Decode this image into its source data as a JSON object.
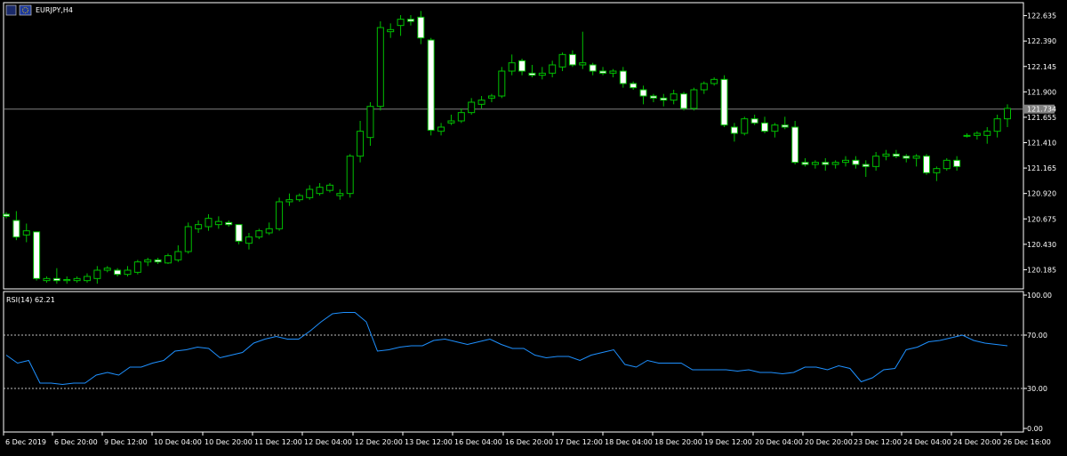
{
  "window": {
    "title": "EURJPY,H4",
    "icons": [
      "chart-window-icon",
      "eu-flag-icon"
    ]
  },
  "colors": {
    "background": "#000000",
    "grid": "#ffffff",
    "bull_candle": "#00c000",
    "bear_body": "#ffffff",
    "wick": "#00c000",
    "rsi_line": "#1e90ff",
    "bid_line": "#808080",
    "level_line": "#c0c0c0",
    "price_tag_bg": "#808080"
  },
  "chart_data": [
    {
      "type": "candlestick",
      "title": "EURJPY,H4",
      "ylim": [
        120.0,
        122.76
      ],
      "y_ticks": [
        "122.635",
        "122.390",
        "122.145",
        "121.900",
        "121.655",
        "121.410",
        "121.165",
        "120.920",
        "120.675",
        "120.430",
        "120.185"
      ],
      "current_price": "121.734",
      "x_labels": [
        "6 Dec 2019",
        "6 Dec 20:00",
        "9 Dec 12:00",
        "10 Dec 04:00",
        "10 Dec 20:00",
        "11 Dec 12:00",
        "12 Dec 04:00",
        "12 Dec 20:00",
        "13 Dec 12:00",
        "16 Dec 04:00",
        "16 Dec 20:00",
        "17 Dec 12:00",
        "18 Dec 04:00",
        "18 Dec 20:00",
        "19 Dec 12:00",
        "20 Dec 04:00",
        "20 Dec 20:00",
        "23 Dec 12:00",
        "24 Dec 04:00",
        "24 Dec 20:00",
        "26 Dec 16:00"
      ],
      "candles": [
        [
          120.72,
          120.74,
          120.68,
          120.7
        ],
        [
          120.66,
          120.75,
          120.47,
          120.5
        ],
        [
          120.52,
          120.63,
          120.45,
          120.56
        ],
        [
          120.55,
          120.55,
          120.08,
          120.1
        ],
        [
          120.08,
          120.12,
          120.06,
          120.1
        ],
        [
          120.1,
          120.2,
          120.05,
          120.08
        ],
        [
          120.08,
          120.12,
          120.05,
          120.09
        ],
        [
          120.08,
          120.12,
          120.06,
          120.1
        ],
        [
          120.08,
          120.15,
          120.06,
          120.12
        ],
        [
          120.1,
          120.22,
          120.05,
          120.18
        ],
        [
          120.18,
          120.22,
          120.16,
          120.2
        ],
        [
          120.18,
          120.2,
          120.12,
          120.14
        ],
        [
          120.14,
          120.22,
          120.12,
          120.18
        ],
        [
          120.16,
          120.28,
          120.14,
          120.26
        ],
        [
          120.26,
          120.3,
          120.22,
          120.28
        ],
        [
          120.28,
          120.3,
          120.24,
          120.26
        ],
        [
          120.25,
          120.34,
          120.24,
          120.32
        ],
        [
          120.28,
          120.42,
          120.26,
          120.36
        ],
        [
          120.36,
          120.64,
          120.34,
          120.6
        ],
        [
          120.58,
          120.66,
          120.54,
          120.62
        ],
        [
          120.6,
          120.72,
          120.56,
          120.68
        ],
        [
          120.62,
          120.7,
          120.58,
          120.65
        ],
        [
          120.64,
          120.66,
          120.6,
          120.62
        ],
        [
          120.62,
          120.62,
          120.43,
          120.46
        ],
        [
          120.44,
          120.54,
          120.38,
          120.5
        ],
        [
          120.5,
          120.58,
          120.48,
          120.56
        ],
        [
          120.54,
          120.64,
          120.52,
          120.58
        ],
        [
          120.58,
          120.88,
          120.56,
          120.84
        ],
        [
          120.84,
          120.92,
          120.8,
          120.86
        ],
        [
          120.86,
          120.92,
          120.84,
          120.9
        ],
        [
          120.88,
          121.0,
          120.86,
          120.96
        ],
        [
          120.92,
          121.02,
          120.9,
          120.98
        ],
        [
          120.95,
          121.02,
          120.93,
          121.0
        ],
        [
          120.9,
          120.96,
          120.86,
          120.92
        ],
        [
          120.92,
          121.3,
          120.88,
          121.28
        ],
        [
          121.28,
          121.62,
          121.22,
          121.52
        ],
        [
          121.46,
          121.8,
          121.38,
          121.76
        ],
        [
          121.76,
          122.58,
          121.72,
          122.52
        ],
        [
          122.48,
          122.56,
          122.42,
          122.5
        ],
        [
          122.54,
          122.64,
          122.44,
          122.6
        ],
        [
          122.6,
          122.64,
          122.54,
          122.58
        ],
        [
          122.62,
          122.68,
          122.36,
          122.42
        ],
        [
          122.4,
          122.42,
          121.48,
          121.53
        ],
        [
          121.52,
          121.6,
          121.48,
          121.56
        ],
        [
          121.6,
          121.68,
          121.58,
          121.62
        ],
        [
          121.62,
          121.74,
          121.6,
          121.7
        ],
        [
          121.7,
          121.84,
          121.68,
          121.8
        ],
        [
          121.78,
          121.86,
          121.74,
          121.82
        ],
        [
          121.84,
          121.88,
          121.8,
          121.86
        ],
        [
          121.86,
          122.14,
          121.84,
          122.1
        ],
        [
          122.1,
          122.26,
          122.06,
          122.18
        ],
        [
          122.2,
          122.22,
          122.06,
          122.1
        ],
        [
          122.08,
          122.16,
          122.04,
          122.06
        ],
        [
          122.06,
          122.14,
          122.02,
          122.08
        ],
        [
          122.08,
          122.2,
          122.04,
          122.16
        ],
        [
          122.14,
          122.28,
          122.1,
          122.26
        ],
        [
          122.26,
          122.3,
          122.14,
          122.16
        ],
        [
          122.16,
          122.48,
          122.12,
          122.18
        ],
        [
          122.16,
          122.18,
          122.06,
          122.1
        ],
        [
          122.1,
          122.14,
          122.06,
          122.08
        ],
        [
          122.08,
          122.12,
          122.04,
          122.1
        ],
        [
          122.1,
          122.14,
          121.94,
          121.98
        ],
        [
          121.98,
          122.0,
          121.92,
          121.94
        ],
        [
          121.92,
          121.96,
          121.78,
          121.86
        ],
        [
          121.86,
          121.88,
          121.8,
          121.84
        ],
        [
          121.84,
          121.88,
          121.76,
          121.82
        ],
        [
          121.82,
          121.92,
          121.78,
          121.88
        ],
        [
          121.88,
          121.9,
          121.72,
          121.74
        ],
        [
          121.74,
          121.94,
          121.72,
          121.92
        ],
        [
          121.92,
          122.0,
          121.88,
          121.98
        ],
        [
          121.98,
          122.04,
          121.96,
          122.02
        ],
        [
          122.02,
          122.06,
          121.56,
          121.58
        ],
        [
          121.56,
          121.6,
          121.42,
          121.5
        ],
        [
          121.5,
          121.66,
          121.48,
          121.64
        ],
        [
          121.64,
          121.68,
          121.58,
          121.6
        ],
        [
          121.6,
          121.66,
          121.5,
          121.52
        ],
        [
          121.52,
          121.6,
          121.46,
          121.58
        ],
        [
          121.58,
          121.66,
          121.54,
          121.56
        ],
        [
          121.56,
          121.62,
          121.2,
          121.22
        ],
        [
          121.22,
          121.26,
          121.18,
          121.2
        ],
        [
          121.2,
          121.24,
          121.16,
          121.22
        ],
        [
          121.22,
          121.26,
          121.14,
          121.2
        ],
        [
          121.2,
          121.24,
          121.16,
          121.22
        ],
        [
          121.22,
          121.28,
          121.18,
          121.24
        ],
        [
          121.24,
          121.28,
          121.16,
          121.2
        ],
        [
          121.2,
          121.24,
          121.08,
          121.18
        ],
        [
          121.18,
          121.32,
          121.14,
          121.28
        ],
        [
          121.28,
          121.34,
          121.24,
          121.3
        ],
        [
          121.3,
          121.34,
          121.26,
          121.28
        ],
        [
          121.28,
          121.3,
          121.22,
          121.26
        ],
        [
          121.26,
          121.3,
          121.18,
          121.28
        ],
        [
          121.28,
          121.3,
          121.1,
          121.12
        ],
        [
          121.12,
          121.18,
          121.04,
          121.16
        ],
        [
          121.16,
          121.26,
          121.14,
          121.24
        ],
        [
          121.24,
          121.28,
          121.14,
          121.18
        ],
        [
          121.48,
          121.5,
          121.46,
          121.48
        ],
        [
          121.48,
          121.52,
          121.44,
          121.5
        ],
        [
          121.48,
          121.56,
          121.4,
          121.52
        ],
        [
          121.52,
          121.68,
          121.46,
          121.64
        ],
        [
          121.64,
          121.78,
          121.56,
          121.74
        ]
      ]
    },
    {
      "type": "line",
      "name": "RSI(14)",
      "title": "RSI(14) 62.21",
      "ylim": [
        0,
        100
      ],
      "y_ticks": [
        "100.00",
        "70.00",
        "30.00",
        "0.00"
      ],
      "levels": [
        70,
        30
      ],
      "values": [
        55,
        49,
        51,
        34,
        34,
        33,
        34,
        34,
        40,
        42,
        40,
        46,
        46,
        49,
        51,
        58,
        59,
        61,
        60,
        53,
        55,
        57,
        64,
        67,
        69,
        67,
        67,
        73,
        80,
        86,
        87,
        87,
        80,
        58,
        59,
        61,
        62,
        62,
        66,
        67,
        65,
        63,
        65,
        67,
        63,
        60,
        60,
        55,
        53,
        54,
        54,
        51,
        55,
        57,
        59,
        48,
        46,
        51,
        49,
        49,
        49,
        44,
        44,
        44,
        44,
        43,
        44,
        42,
        42,
        41,
        42,
        46,
        46,
        44,
        47,
        45,
        35,
        38,
        44,
        45,
        59,
        61,
        65,
        66,
        68,
        70,
        66,
        64,
        63,
        62
      ]
    }
  ]
}
